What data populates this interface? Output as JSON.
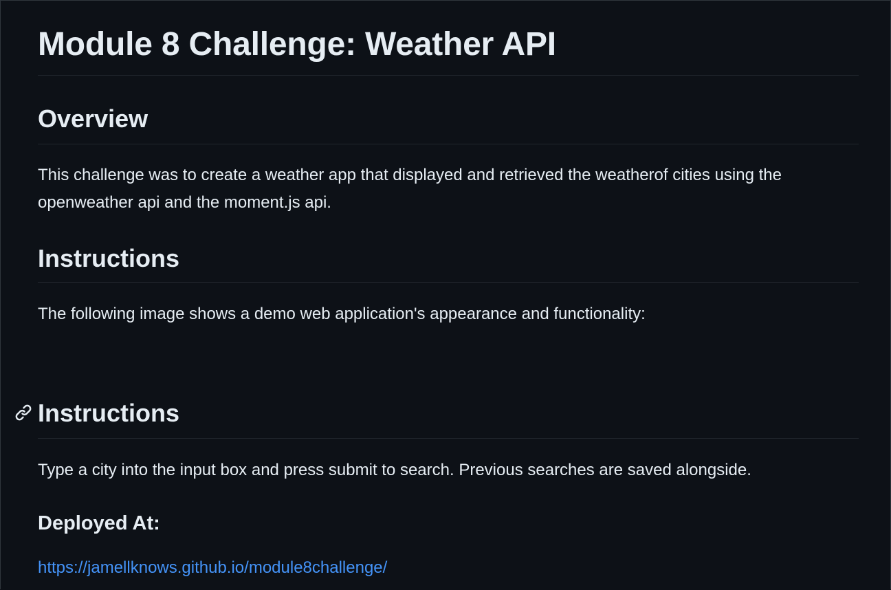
{
  "readme": {
    "title": "Module 8 Challenge: Weather API",
    "overview_heading": "Overview",
    "overview_text_line1": "This challenge was to create a weather app that displayed and retrieved the weatherof cities using the",
    "overview_text_line2": "openweather api and the moment.js api.",
    "instructions_heading_1": "Instructions",
    "instructions_text_1": "The following image shows a demo web application's appearance and functionality:",
    "instructions_heading_2": "Instructions",
    "instructions_text_2": "Type a city into the input box and press submit to search. Previous searches are saved alongside.",
    "deployed_heading": "Deployed At:",
    "deployed_link": "https://jamellknows.github.io/module8challenge/"
  },
  "icons": {
    "heading_anchor": "link-icon"
  },
  "colors": {
    "background": "#0d1117",
    "text": "#e6edf3",
    "link": "#4493f8",
    "rule": "#21262d"
  }
}
